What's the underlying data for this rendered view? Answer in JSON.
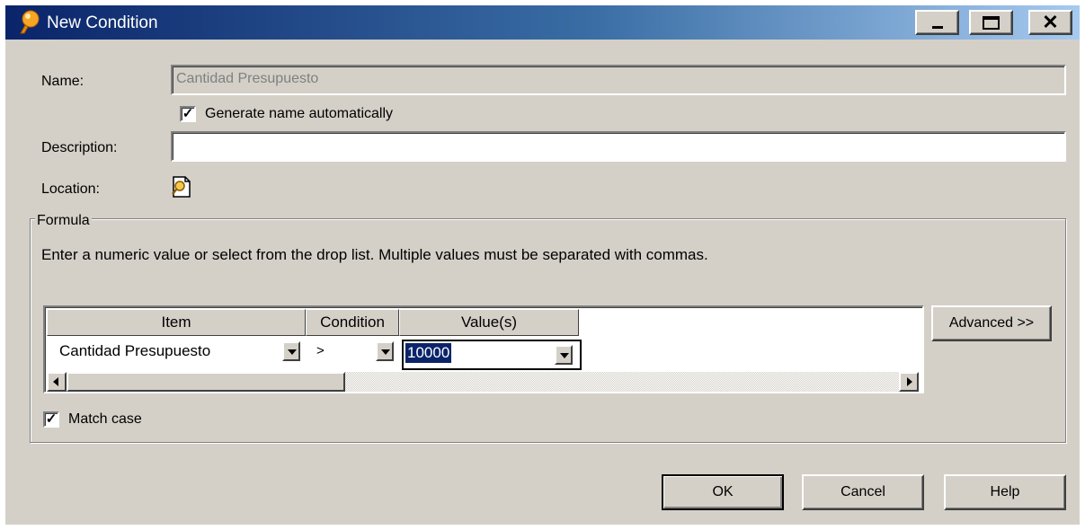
{
  "window": {
    "title": "New Condition"
  },
  "form": {
    "name_label": "Name:",
    "name_value": "Cantidad Presupuesto",
    "generate_name_label": "Generate name automatically",
    "generate_name_checked": true,
    "description_label": "Description:",
    "description_value": "",
    "location_label": "Location:"
  },
  "formula": {
    "legend": "Formula",
    "instructions": "Enter a numeric value or select from the drop list. Multiple values must be separated with commas.",
    "columns": [
      "Item",
      "Condition",
      "Value(s)"
    ],
    "row": {
      "item": "Cantidad Presupuesto",
      "condition": ">",
      "value": "10000"
    },
    "advanced_label": "Advanced >>",
    "match_case_label": "Match case",
    "match_case_checked": true
  },
  "buttons": {
    "ok": "OK",
    "cancel": "Cancel",
    "help": "Help"
  },
  "icons": {
    "app": "bulb-icon",
    "location": "location-browse-icon"
  }
}
